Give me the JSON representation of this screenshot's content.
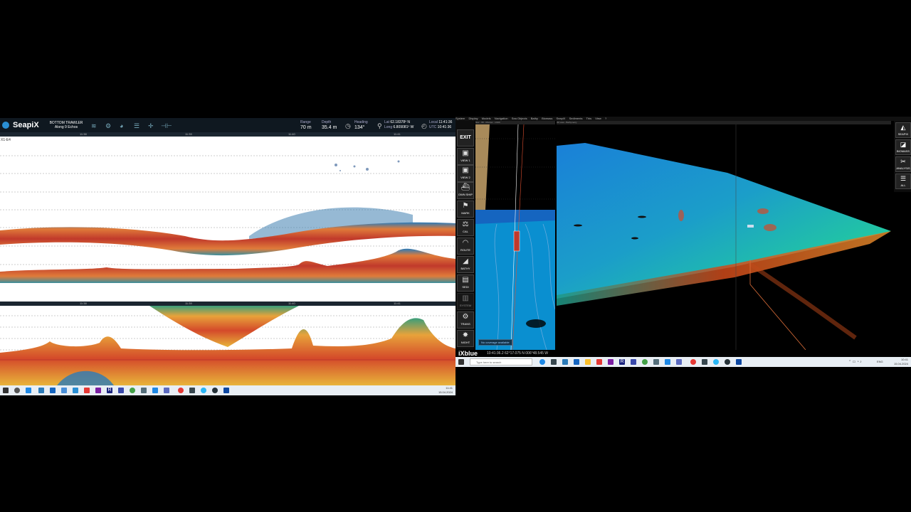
{
  "seapix": {
    "app_name": "SeapiX",
    "mode_line1": "BOTTOM TRAWLER",
    "mode_line2": "Along 9 Echos",
    "range_label": "Range",
    "range_value": "70 m",
    "depth_label": "Depth",
    "depth_value": "35.4 m",
    "heading_label": "Heading",
    "heading_value": "134°",
    "lat_label": "Lat",
    "lat_value": "62.18378º N",
    "long_label": "Long",
    "long_value": "6.809081º W",
    "local_label": "Local",
    "local_value": "11:41:36",
    "utc_label": "UTC",
    "utc_value": "10:41:36",
    "top_times": [
      "11:38",
      "11:39",
      "11:40",
      "11:41"
    ],
    "panel_label": "X1-E4",
    "bottom_times": [
      "11:38",
      "11:39",
      "11:40",
      "11:41"
    ],
    "clock_time": "11:41",
    "clock_date": "15.04.2024"
  },
  "ixblue": {
    "menu": [
      "System",
      "Display",
      "Models",
      "Navigation",
      "Sea Objects",
      "Bathy",
      "Biomass",
      "SeapiX",
      "Sediments",
      "This",
      "View",
      "?"
    ],
    "exit_label": "EXIT",
    "left_buttons": [
      "VIEW 1",
      "VIEW 2",
      "OWN SHIP",
      "MARK",
      "CAL",
      "ROUTE",
      "BATHY",
      "SEDI",
      "SYSTEM",
      "TRANS",
      "NIGHT"
    ],
    "right_buttons": [
      "SEAPIX",
      "BIOMASS",
      "ANALYSIS",
      "ALL"
    ],
    "window_title_left": "Nav - 3D - Monitor - 1/100",
    "window_title_right": "3D view - Bathymetry",
    "overlay_label": "No coverage available",
    "brand": "iXblue",
    "status_text": "10:41:36.2   62°17.075 N   006°48.545 W",
    "search_placeholder": "Type here to search",
    "clock_time": "10:41",
    "clock_date": "15.04.2024",
    "lang": "ENG"
  },
  "colors": {
    "accent": "#2a8fd4",
    "echo_red": "#c0392b",
    "bathy_blue": "#1a80d8",
    "bathy_green": "#22c9a0"
  }
}
